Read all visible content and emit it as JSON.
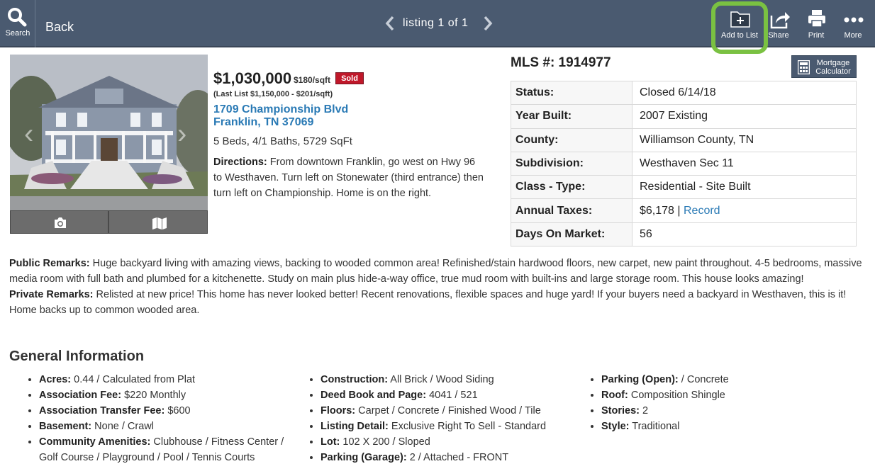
{
  "topbar": {
    "search_label": "Search",
    "back_label": "Back",
    "listing_nav": "listing 1 of 1",
    "add_to_list": "Add to List",
    "share": "Share",
    "print": "Print",
    "more": "More",
    "highlight_color": "#7ac142"
  },
  "listing": {
    "price": "$1,030,000",
    "price_per_sqft": "$180/sqft",
    "status_badge": "Sold",
    "last_list": "(Last List $1,150,000 - $201/sqft)",
    "address_line1": "1709 Championship Blvd",
    "address_line2": "Franklin, TN 37069",
    "beds_baths_sqft": "5 Beds, 4/1 Baths, 5729 SqFt",
    "directions_label": "Directions:",
    "directions": "From downtown Franklin, go west on Hwy 96 to Westhaven. Turn left on Stonewater (third entrance) then turn left on Championship. Home is on the right."
  },
  "mls": {
    "number": "MLS #: 1914977",
    "mortgage_line1": "Mortgage",
    "mortgage_line2": "Calculator",
    "rows": [
      {
        "label": "Status:",
        "value": "Closed 6/14/18"
      },
      {
        "label": "Year Built:",
        "value": "2007 Existing"
      },
      {
        "label": "County:",
        "value": "Williamson County, TN"
      },
      {
        "label": "Subdivision:",
        "value": "Westhaven Sec 11"
      },
      {
        "label": "Class - Type:",
        "value": "Residential - Site Built"
      },
      {
        "label": "Annual Taxes:",
        "value": "$6,178",
        "separator": " | ",
        "link": "Record"
      },
      {
        "label": "Days On Market:",
        "value": "56"
      }
    ]
  },
  "remarks": {
    "public_label": "Public Remarks:",
    "public": "Huge backyard living with amazing views, backing to wooded common area! Refinished/stain hardwood floors, new carpet, new paint throughout. 4-5 bedrooms, massive media room with full bath and plumbed for a kitchenette. Study on main plus hide-a-way office, true mud room with built-ins and large storage room. This house looks amazing!",
    "private_label": "Private Remarks:",
    "private": "Relisted at new price! This home has never looked better! Recent renovations, flexible spaces and huge yard! If your buyers need a backyard in Westhaven, this is it! Home backs up to common wooded area."
  },
  "general": {
    "title": "General Information",
    "col1": [
      {
        "k": "Acres:",
        "v": "0.44 / Calculated from Plat"
      },
      {
        "k": "Association Fee:",
        "v": "$220 Monthly"
      },
      {
        "k": "Association Transfer Fee:",
        "v": "$600"
      },
      {
        "k": "Basement:",
        "v": "None / Crawl"
      },
      {
        "k": "Community Amenities:",
        "v": "Clubhouse / Fitness Center / Golf Course / Playground / Pool / Tennis Courts"
      }
    ],
    "col2": [
      {
        "k": "Construction:",
        "v": "All Brick / Wood Siding"
      },
      {
        "k": "Deed Book and Page:",
        "v": "4041 / 521"
      },
      {
        "k": "Floors:",
        "v": "Carpet / Concrete / Finished Wood / Tile"
      },
      {
        "k": "Listing Detail:",
        "v": "Exclusive Right To Sell - Standard"
      },
      {
        "k": "Lot:",
        "v": "102 X 200 / Sloped"
      },
      {
        "k": "Parking (Garage):",
        "v": "2 / Attached - FRONT"
      }
    ],
    "col3": [
      {
        "k": "Parking (Open):",
        "v": "/ Concrete"
      },
      {
        "k": "Roof:",
        "v": "Composition Shingle"
      },
      {
        "k": "Stories:",
        "v": "2"
      },
      {
        "k": "Style:",
        "v": "Traditional"
      }
    ]
  }
}
